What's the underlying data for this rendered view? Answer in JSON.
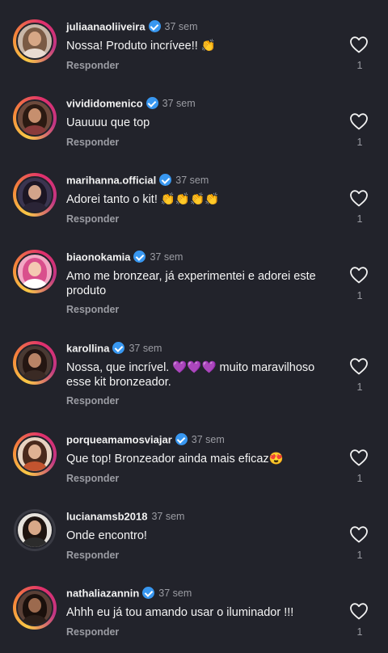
{
  "comments": [
    {
      "username": "juliaanaoliiveira",
      "verified": true,
      "time": "37 sem",
      "text": "Nossa! Produto incrívee!! 👏",
      "reply": "Responder",
      "likes": "1"
    },
    {
      "username": "vivididomenico",
      "verified": true,
      "time": "37 sem",
      "text": "Uauuuu que top",
      "reply": "Responder",
      "likes": "1"
    },
    {
      "username": "marihanna.official",
      "verified": true,
      "time": "37 sem",
      "text": "Adorei tanto o kit! 👏👏👏👏",
      "reply": "Responder",
      "likes": "1"
    },
    {
      "username": "biaonokamia",
      "verified": true,
      "time": "37 sem",
      "text": "Amo me bronzear, já experimentei e adorei este produto",
      "reply": "Responder",
      "likes": "1"
    },
    {
      "username": "karollina",
      "verified": true,
      "time": "37 sem",
      "text": "Nossa, que incrível. 💜💜💜 muito maravilhoso esse kit bronzeador.",
      "reply": "Responder",
      "likes": "1"
    },
    {
      "username": "porqueamamosviajar",
      "verified": true,
      "time": "37 sem",
      "text": "Que top! Bronzeador ainda mais eficaz😍",
      "reply": "Responder",
      "likes": "1"
    },
    {
      "username": "lucianamsb2018",
      "verified": false,
      "time": "37 sem",
      "text": "Onde encontro!",
      "reply": "Responder",
      "likes": "1"
    },
    {
      "username": "nathaliazannin",
      "verified": true,
      "time": "37 sem",
      "text": "Ahhh eu já tou amando usar o iluminador !!!",
      "reply": "Responder",
      "likes": "1"
    }
  ],
  "colors": {
    "background": "#22232b",
    "verified": "#3897f0",
    "secondary_text": "#9b9ca3"
  },
  "icons": {
    "verified": "verified-badge-icon",
    "like": "heart-outline-icon"
  }
}
